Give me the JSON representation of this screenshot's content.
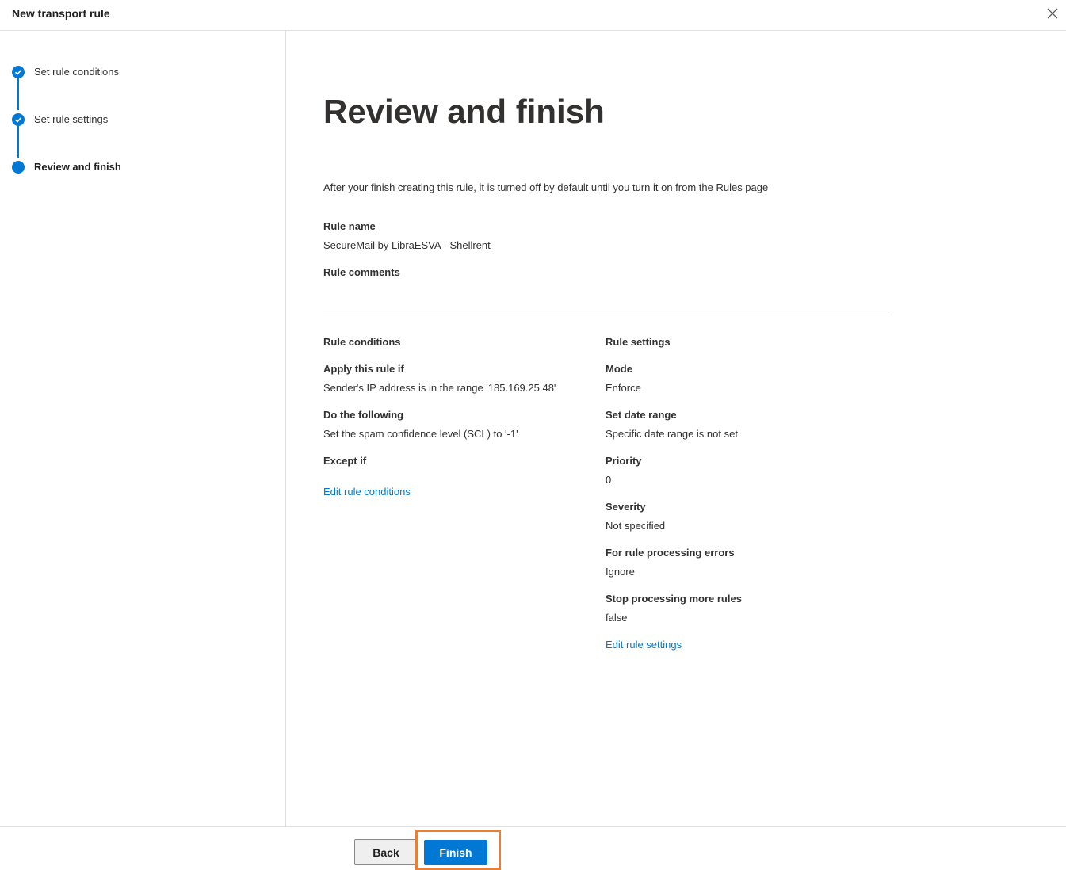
{
  "header": {
    "title": "New transport rule"
  },
  "steps": [
    {
      "label": "Set rule conditions",
      "state": "complete"
    },
    {
      "label": "Set rule settings",
      "state": "complete"
    },
    {
      "label": "Review and finish",
      "state": "current"
    }
  ],
  "page": {
    "title": "Review and finish",
    "intro": "After your finish creating this rule, it is turned off by default until you turn it on from the Rules page",
    "rule_name_label": "Rule name",
    "rule_name_value": "SecureMail by LibraESVA - Shellrent",
    "rule_comments_label": "Rule comments"
  },
  "conditions": {
    "heading": "Rule conditions",
    "apply_label": "Apply this rule if",
    "apply_value": "Sender's IP address is in the range '185.169.25.48'",
    "do_label": "Do the following",
    "do_value": "Set the spam confidence level (SCL) to '-1'",
    "except_label": "Except if",
    "edit_link": "Edit rule conditions"
  },
  "settings": {
    "heading": "Rule settings",
    "mode_label": "Mode",
    "mode_value": "Enforce",
    "date_label": "Set date range",
    "date_value": "Specific date range is not set",
    "priority_label": "Priority",
    "priority_value": "0",
    "severity_label": "Severity",
    "severity_value": "Not specified",
    "errors_label": "For rule processing errors",
    "errors_value": "Ignore",
    "stop_label": "Stop processing more rules",
    "stop_value": "false",
    "edit_link": "Edit rule settings"
  },
  "footer": {
    "back_label": "Back",
    "finish_label": "Finish"
  },
  "colors": {
    "accent": "#0078d4",
    "highlight": "#ed7d31"
  }
}
